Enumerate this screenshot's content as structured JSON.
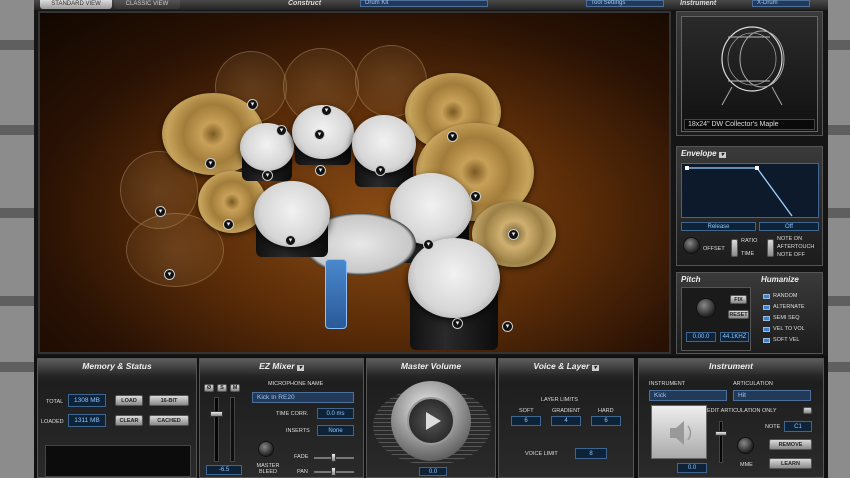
{
  "topbar": {
    "tab_standard": "STANDARD VIEW",
    "tab_classic": "CLASSIC VIEW",
    "construct_label": "Construct",
    "construct_value": "Drum Kit",
    "tool_settings": "Tool Settings",
    "instrument_label": "Instrument",
    "instrument_value": "X-Drum"
  },
  "instrument_preview": {
    "caption": "18x24\" DW Collector's Maple"
  },
  "envelope": {
    "title": "Envelope",
    "mode": "Release",
    "value": "Off",
    "offset": "OFFSET",
    "ratio": "RATIO",
    "time": "TIME",
    "note_on": "NOTE ON",
    "aftertouch": "AFTERTOUCH",
    "note_off": "NOTE OFF"
  },
  "pitch": {
    "title": "Pitch",
    "fix": "FIX",
    "reset": "RESET",
    "value": "0.00.0",
    "rate": "44.1KHZ"
  },
  "humanize": {
    "title": "Humanize",
    "items": [
      "RANDOM",
      "ALTERNATE",
      "SEMI SEQ",
      "VEL TO VOL",
      "SOFT VEL"
    ]
  },
  "memory": {
    "title": "Memory & Status",
    "total_label": "TOTAL",
    "total_value": "1308 MB",
    "loaded_label": "LOADED",
    "loaded_value": "1311 MB",
    "load": "LOAD",
    "clear": "CLEAR",
    "bit16": "16-BIT",
    "cached": "CACHED"
  },
  "mixer": {
    "title": "EZ Mixer",
    "mic_label": "MICROPHONE NAME",
    "mic_value": "Kick In RE20",
    "time_corr_label": "TIME CORR.",
    "time_corr_value": "0.0 ms",
    "inserts_label": "INSERTS",
    "inserts_value": "None",
    "fade_label": "FADE",
    "pan_label": "PAN",
    "master_bleed": "MASTER BLEED",
    "fader_value": "-6.5",
    "btn_s": "S",
    "btn_m": "M",
    "btn_phase": "Ø"
  },
  "master": {
    "title": "Master Volume",
    "value": "0.0"
  },
  "voice": {
    "title": "Voice & Layer",
    "layer_limits": "LAYER LIMITS",
    "soft_label": "SOFT",
    "soft_value": "6",
    "gradient_label": "GRADIENT",
    "gradient_value": "4",
    "hard_label": "HARD",
    "hard_value": "6",
    "voice_limit_label": "VOICE LIMIT",
    "voice_limit_value": "8"
  },
  "instrument_panel": {
    "title": "Instrument",
    "instrument_label": "INSTRUMENT",
    "instrument_value": "Kick",
    "articulation_label": "ARTICULATION",
    "articulation_value": "Hit",
    "edit_articulation": "EDIT ARTICULATION ONLY",
    "note_label": "NOTE",
    "note_value": "C1",
    "remove": "REMOVE",
    "learn": "LEARN",
    "mme": "MME",
    "value": "0.0"
  }
}
